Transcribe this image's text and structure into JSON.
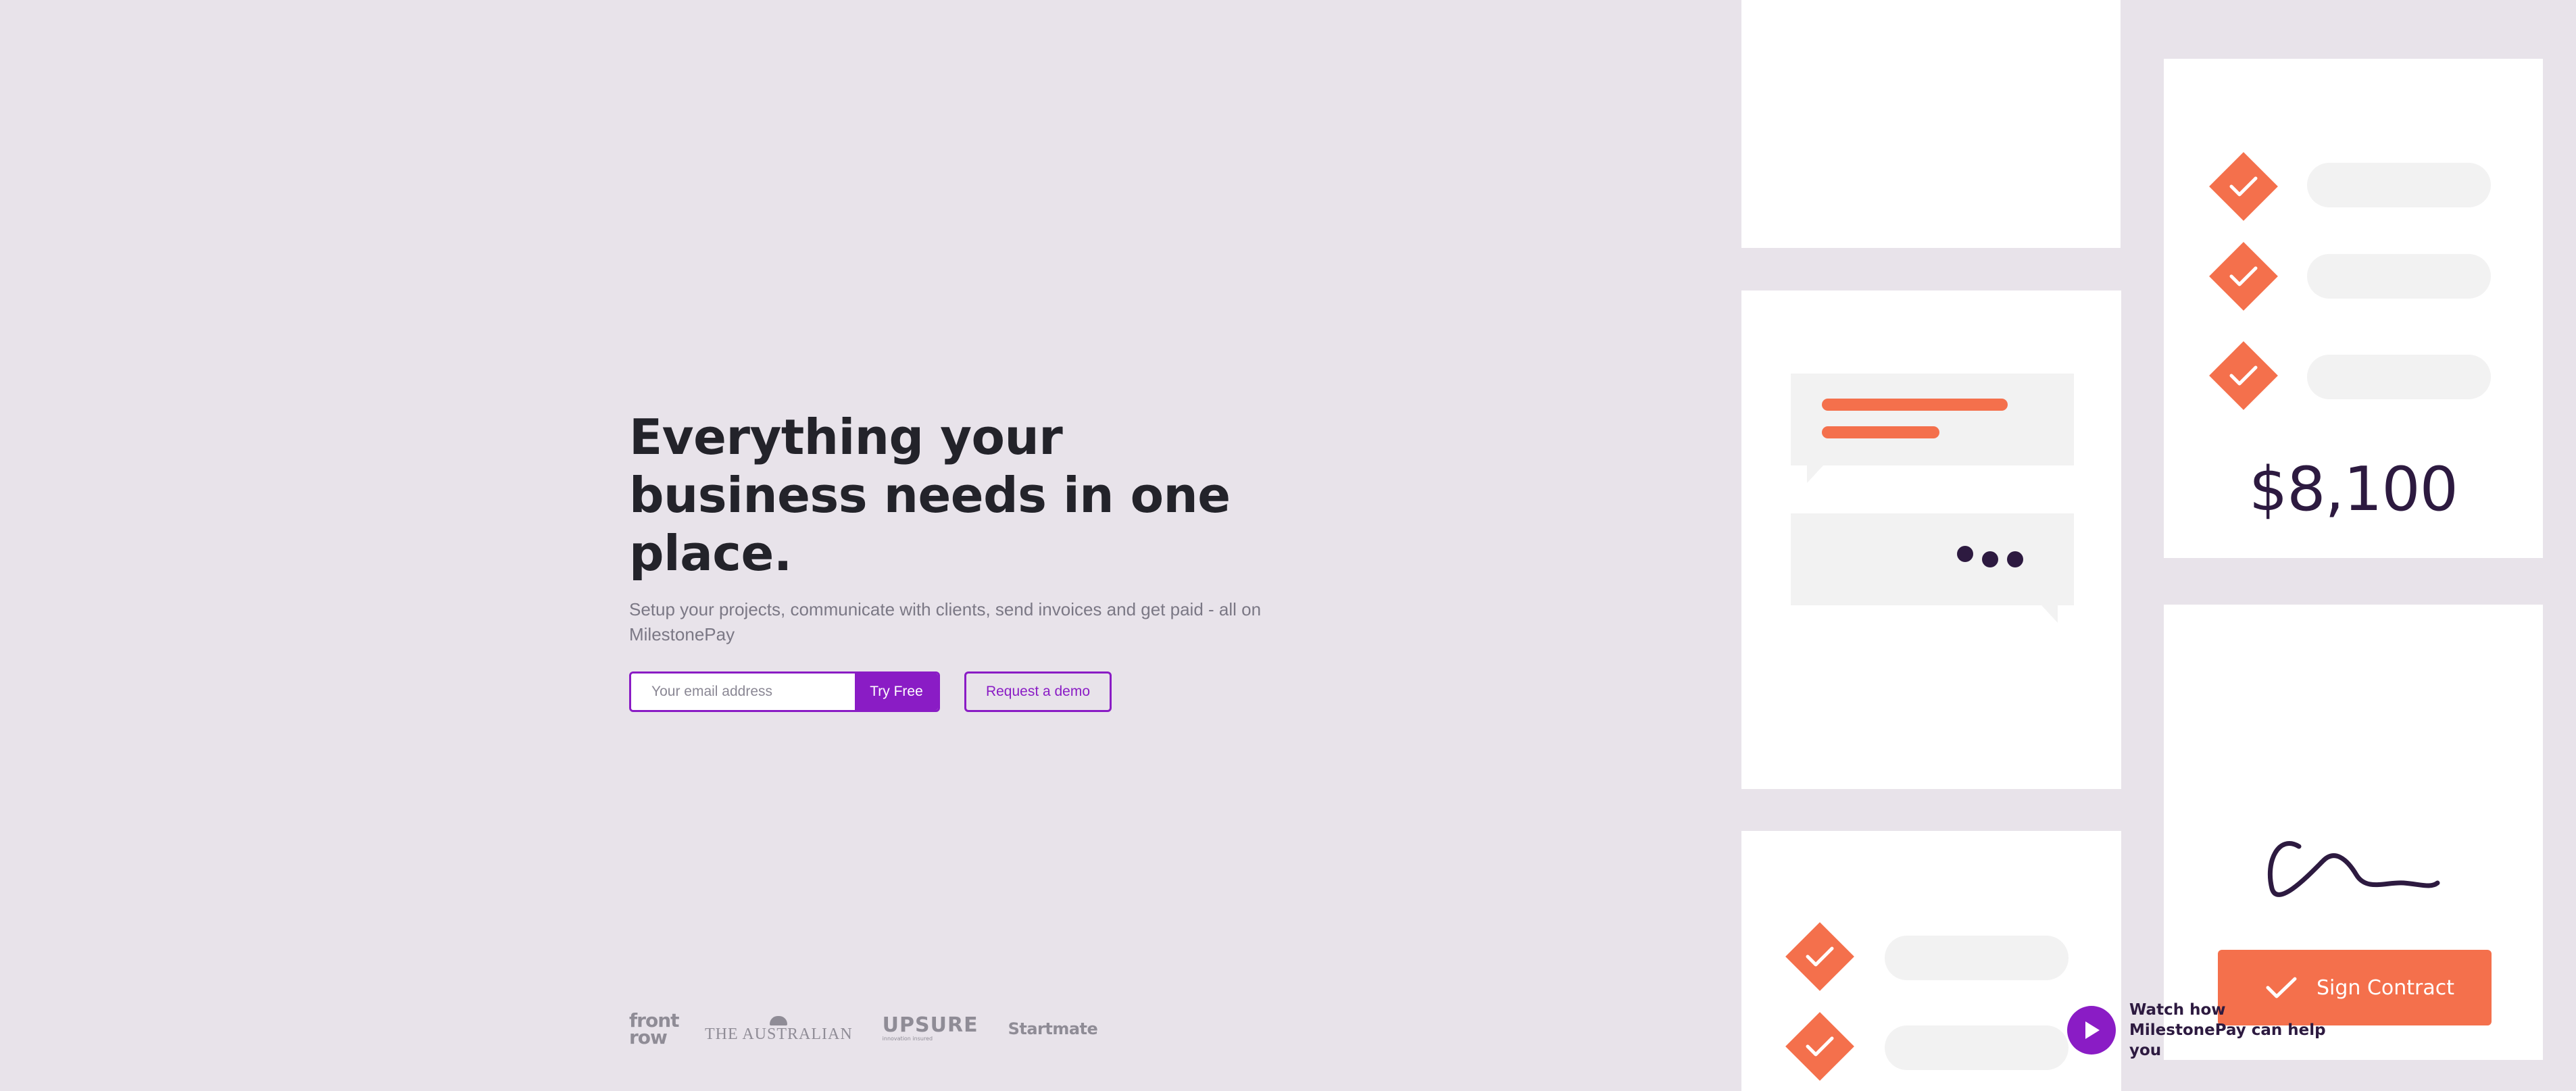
{
  "hero": {
    "title": "Everything your business needs in one place.",
    "subtitle": "Setup your projects, communicate with clients, send invoices and get paid - all on MilestonePay",
    "email_placeholder": "Your email address",
    "try_button": "Try Free",
    "demo_button": "Request a demo"
  },
  "logos": {
    "frontrow": "front row",
    "australian": "THE AUSTRALIAN",
    "upsure": "UPSURE",
    "upsure_tagline": "innovation insured",
    "startmate": "Startmate"
  },
  "illustration": {
    "amount": "$8,100",
    "sign_contract": "Sign Contract"
  },
  "video": {
    "label": "Watch how MilestonePay can help you"
  },
  "colors": {
    "background": "#e8e3ea",
    "brand_purple": "#8a1cc5",
    "accent_orange": "#f4704c",
    "dark_plum": "#2d1a40"
  },
  "icons": [
    "check-icon",
    "play-icon",
    "signature-icon",
    "typing-dots-icon"
  ]
}
